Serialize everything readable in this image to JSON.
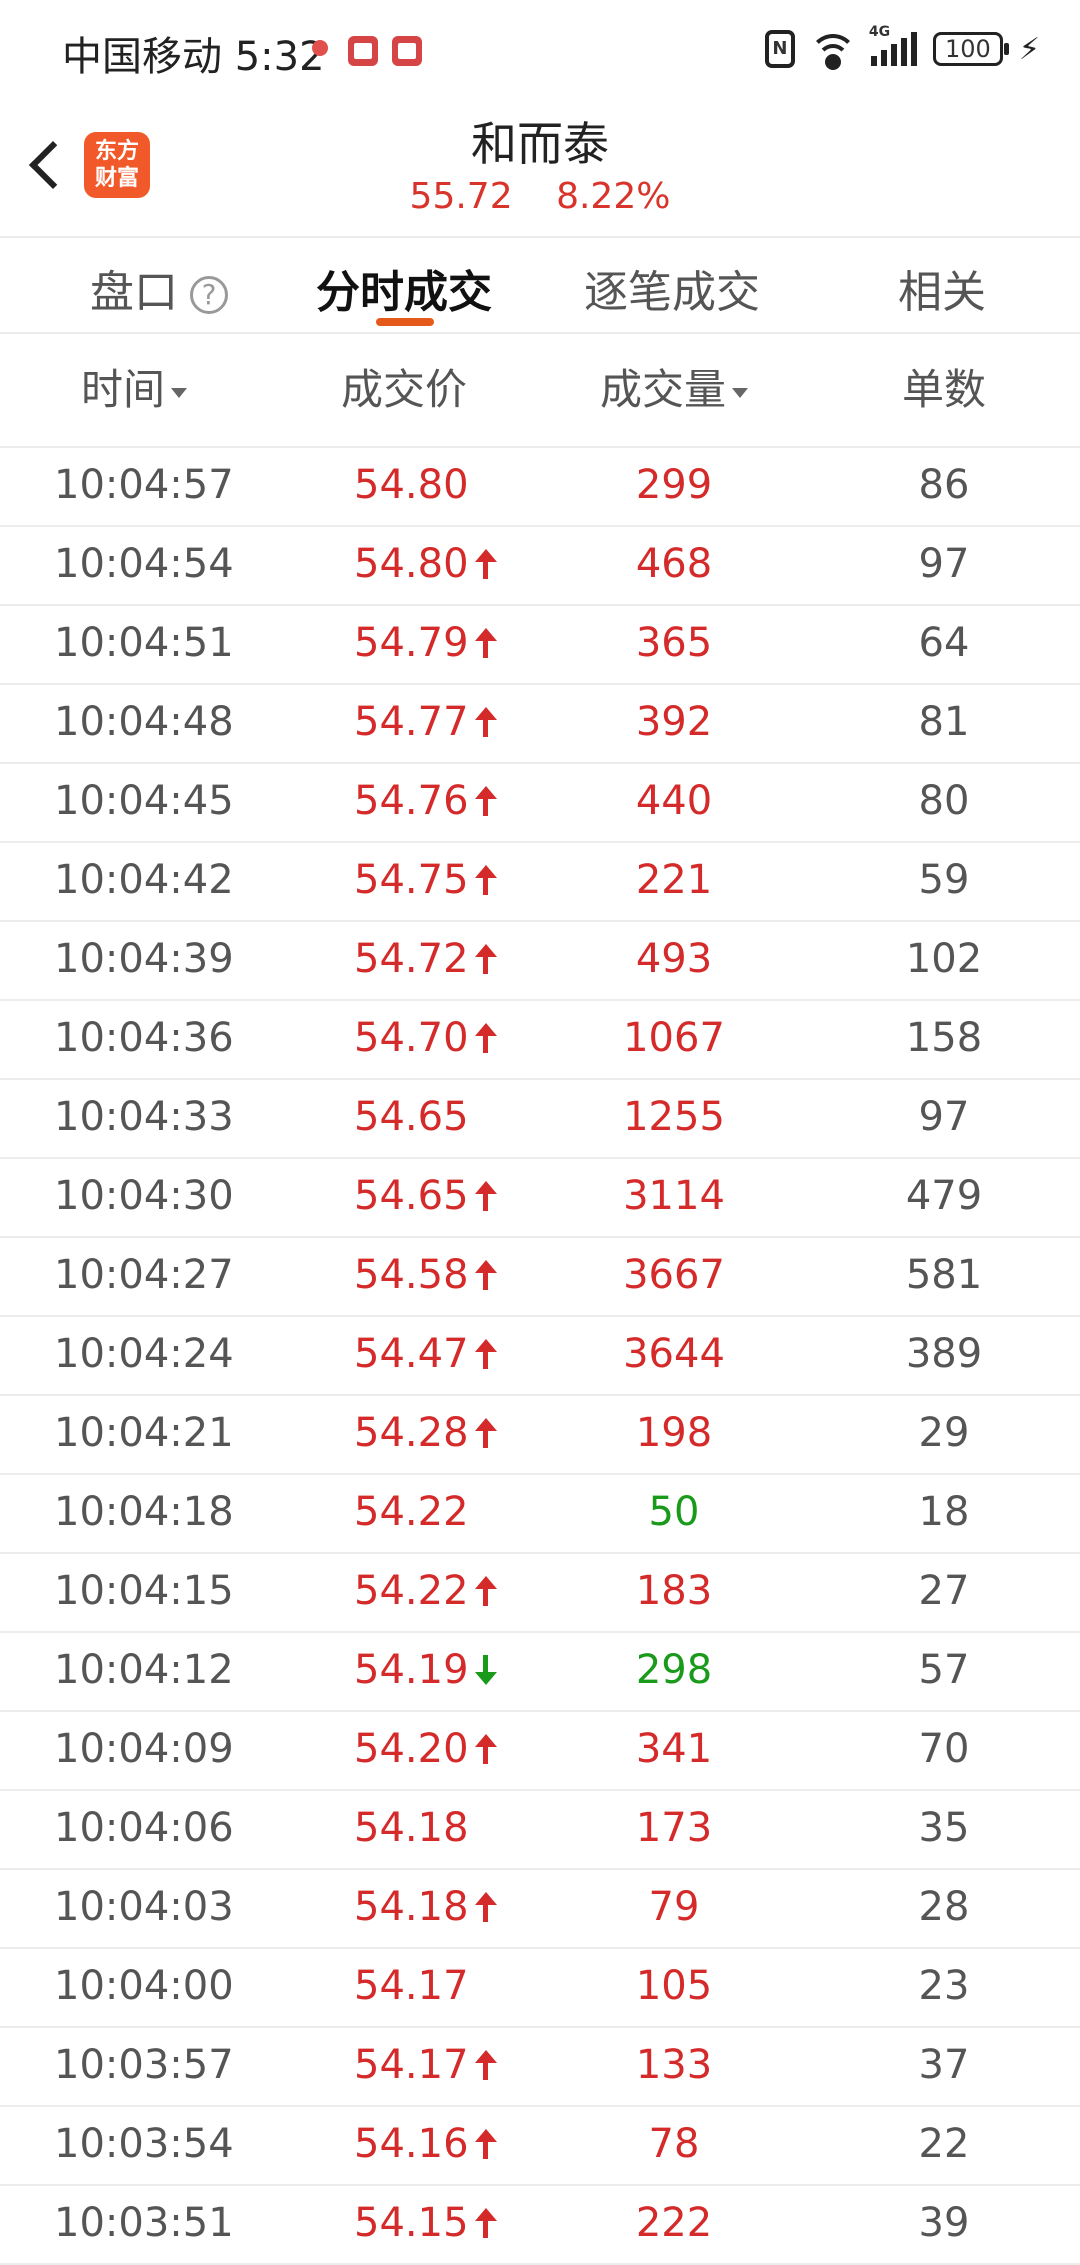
{
  "status_bar": {
    "carrier": "中国移动",
    "time": "5:32",
    "battery": "100",
    "network": "4G"
  },
  "header": {
    "logo_line1": "东方",
    "logo_line2": "财富",
    "stock_name": "和而泰",
    "price": "55.72",
    "change_pct": "8.22%"
  },
  "tabs": [
    {
      "label": "盘口",
      "active": false
    },
    {
      "label": "分时成交",
      "active": true
    },
    {
      "label": "逐笔成交",
      "active": false
    },
    {
      "label": "相关",
      "active": false
    }
  ],
  "columns": {
    "time": "时间",
    "price": "成交价",
    "volume": "成交量",
    "count": "单数"
  },
  "colors": {
    "up": "#d42a2a",
    "down": "#1a9a1a",
    "accent": "#e55a1a"
  },
  "rows": [
    {
      "time": "10:04:57",
      "price": "54.80",
      "dir": "",
      "volume": "299",
      "vol_color": "red",
      "count": "86"
    },
    {
      "time": "10:04:54",
      "price": "54.80",
      "dir": "up",
      "volume": "468",
      "vol_color": "red",
      "count": "97"
    },
    {
      "time": "10:04:51",
      "price": "54.79",
      "dir": "up",
      "volume": "365",
      "vol_color": "red",
      "count": "64"
    },
    {
      "time": "10:04:48",
      "price": "54.77",
      "dir": "up",
      "volume": "392",
      "vol_color": "red",
      "count": "81"
    },
    {
      "time": "10:04:45",
      "price": "54.76",
      "dir": "up",
      "volume": "440",
      "vol_color": "red",
      "count": "80"
    },
    {
      "time": "10:04:42",
      "price": "54.75",
      "dir": "up",
      "volume": "221",
      "vol_color": "red",
      "count": "59"
    },
    {
      "time": "10:04:39",
      "price": "54.72",
      "dir": "up",
      "volume": "493",
      "vol_color": "red",
      "count": "102"
    },
    {
      "time": "10:04:36",
      "price": "54.70",
      "dir": "up",
      "volume": "1067",
      "vol_color": "red",
      "count": "158"
    },
    {
      "time": "10:04:33",
      "price": "54.65",
      "dir": "",
      "volume": "1255",
      "vol_color": "red",
      "count": "97"
    },
    {
      "time": "10:04:30",
      "price": "54.65",
      "dir": "up",
      "volume": "3114",
      "vol_color": "red",
      "count": "479"
    },
    {
      "time": "10:04:27",
      "price": "54.58",
      "dir": "up",
      "volume": "3667",
      "vol_color": "red",
      "count": "581"
    },
    {
      "time": "10:04:24",
      "price": "54.47",
      "dir": "up",
      "volume": "3644",
      "vol_color": "red",
      "count": "389"
    },
    {
      "time": "10:04:21",
      "price": "54.28",
      "dir": "up",
      "volume": "198",
      "vol_color": "red",
      "count": "29"
    },
    {
      "time": "10:04:18",
      "price": "54.22",
      "dir": "",
      "volume": "50",
      "vol_color": "green",
      "count": "18"
    },
    {
      "time": "10:04:15",
      "price": "54.22",
      "dir": "up",
      "volume": "183",
      "vol_color": "red",
      "count": "27"
    },
    {
      "time": "10:04:12",
      "price": "54.19",
      "dir": "down",
      "volume": "298",
      "vol_color": "green",
      "count": "57"
    },
    {
      "time": "10:04:09",
      "price": "54.20",
      "dir": "up",
      "volume": "341",
      "vol_color": "red",
      "count": "70"
    },
    {
      "time": "10:04:06",
      "price": "54.18",
      "dir": "",
      "volume": "173",
      "vol_color": "red",
      "count": "35"
    },
    {
      "time": "10:04:03",
      "price": "54.18",
      "dir": "up",
      "volume": "79",
      "vol_color": "red",
      "count": "28"
    },
    {
      "time": "10:04:00",
      "price": "54.17",
      "dir": "",
      "volume": "105",
      "vol_color": "red",
      "count": "23"
    },
    {
      "time": "10:03:57",
      "price": "54.17",
      "dir": "up",
      "volume": "133",
      "vol_color": "red",
      "count": "37"
    },
    {
      "time": "10:03:54",
      "price": "54.16",
      "dir": "up",
      "volume": "78",
      "vol_color": "red",
      "count": "22"
    },
    {
      "time": "10:03:51",
      "price": "54.15",
      "dir": "up",
      "volume": "222",
      "vol_color": "red",
      "count": "39"
    }
  ]
}
